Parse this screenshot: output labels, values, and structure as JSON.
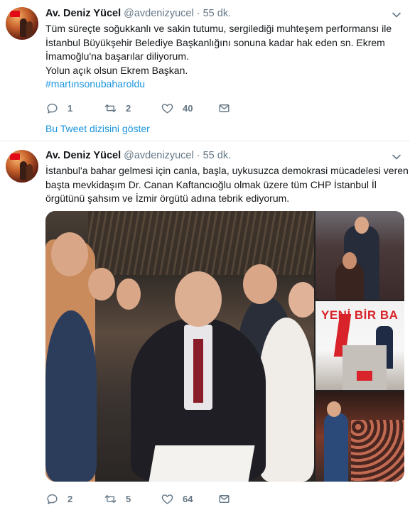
{
  "tweets": [
    {
      "author_name": "Av. Deniz Yücel",
      "handle": "@avdenizyucel",
      "separator": "·",
      "time": "55 dk.",
      "lines": [
        "Tüm süreçte soğukkanlı ve sakin tutumu, sergilediği muhteşem performansı ile",
        "İstanbul Büyükşehir Belediye Başkanlığını sonuna kadar hak eden sn. Ekrem",
        "İmamoğlu'na başarılar diliyorum.",
        "Yolun açık olsun Ekrem Başkan."
      ],
      "hashtag": "#martınsonubaharoldu",
      "replies": "1",
      "retweets": "2",
      "likes": "40",
      "thread_link": "Bu Tweet dizisini göster"
    },
    {
      "author_name": "Av. Deniz Yücel",
      "handle": "@avdenizyucel",
      "separator": "·",
      "time": "55 dk.",
      "lines": [
        "İstanbul'a bahar gelmesi için canla, başla, uykusuzca demokrasi mücadelesi veren",
        "başta mevkidaşım Dr. Canan Kaftancıoğlu olmak üzere tüm CHP İstanbul İl",
        "örgütünü şahsım ve İzmir örgütü adına tebrik ediyorum."
      ],
      "media_banner_text": "YENİ BİR BA",
      "replies": "2",
      "retweets": "5",
      "likes": "64"
    }
  ],
  "colors": {
    "text": "#14171a",
    "secondary": "#657786",
    "link": "#1b95e0",
    "divider": "#e6ecf0",
    "flag_red": "#e30a17"
  },
  "icons": {
    "reply": "reply-icon",
    "retweet": "retweet-icon",
    "like": "heart-icon",
    "dm": "envelope-icon",
    "menu": "chevron-down-icon"
  }
}
